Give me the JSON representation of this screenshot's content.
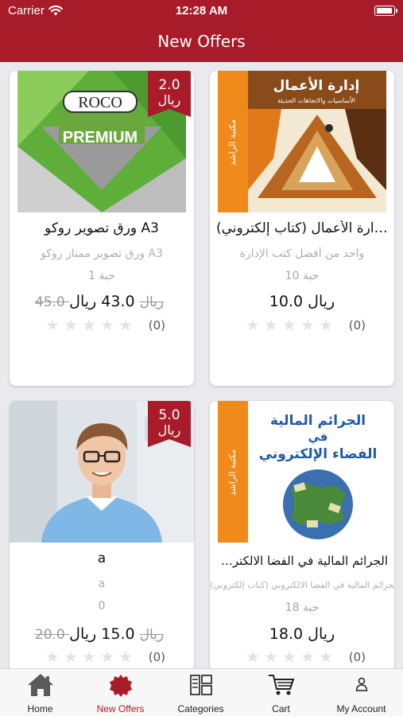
{
  "status_bar": {
    "carrier": "Carrier",
    "time": "12:28 AM"
  },
  "nav": {
    "title": "New Offers"
  },
  "products": [
    {
      "name": "ورق تصوير روكو A3",
      "description": "ورق تصوير ممتاز روكو A3",
      "quantity": "1 حبة",
      "price": "43.0 ريال",
      "old_price": "45.0 ريال",
      "discount": "2.0",
      "discount_currency": "ريال",
      "rating_count": "(0)",
      "image": {
        "brand": "ROCO",
        "label": "PREMIUM"
      }
    },
    {
      "name": "مبادئ إدارة الأعمال (كتاب إلكتروني)",
      "description": "واحد من أفضل كتب الإدارة",
      "quantity": "10 حبة",
      "price": "10.0 ريال",
      "rating_count": "(0)",
      "image": {
        "title": "إدارة الأعمال",
        "subtitle": "الأساسيات والاتجاهات الحديثة",
        "spine": "مكتبة الراشد"
      }
    },
    {
      "name": "a",
      "description": "a",
      "quantity": "0",
      "price": "15.0 ريال",
      "old_price": "20.0 ريال",
      "discount": "5.0",
      "discount_currency": "ريال",
      "rating_count": "(0)"
    },
    {
      "name": "الجرائم المالية في الفضا الالكتروني (كت...",
      "description": "الجرائم المالية في الفضا الالكتروني (كتاب إلكتروني)",
      "quantity": "18 حبة",
      "price": "18.0 ريال",
      "rating_count": "(0)",
      "image": {
        "title_1": "الجرائم المالية",
        "title_2": "في",
        "title_3": "الفضاء الإلكتروني",
        "spine": "مكتبة الراشد"
      }
    }
  ],
  "tabs": [
    {
      "label": "Home",
      "icon": "home-icon"
    },
    {
      "label": "New Offers",
      "icon": "badge-icon",
      "active": true
    },
    {
      "label": "Categories",
      "icon": "categories-icon"
    },
    {
      "label": "Cart",
      "icon": "cart-icon"
    },
    {
      "label": "My Account",
      "icon": "user-icon"
    }
  ],
  "colors": {
    "brand": "#a81c2a",
    "inactive_star": "#e3e3e3"
  }
}
